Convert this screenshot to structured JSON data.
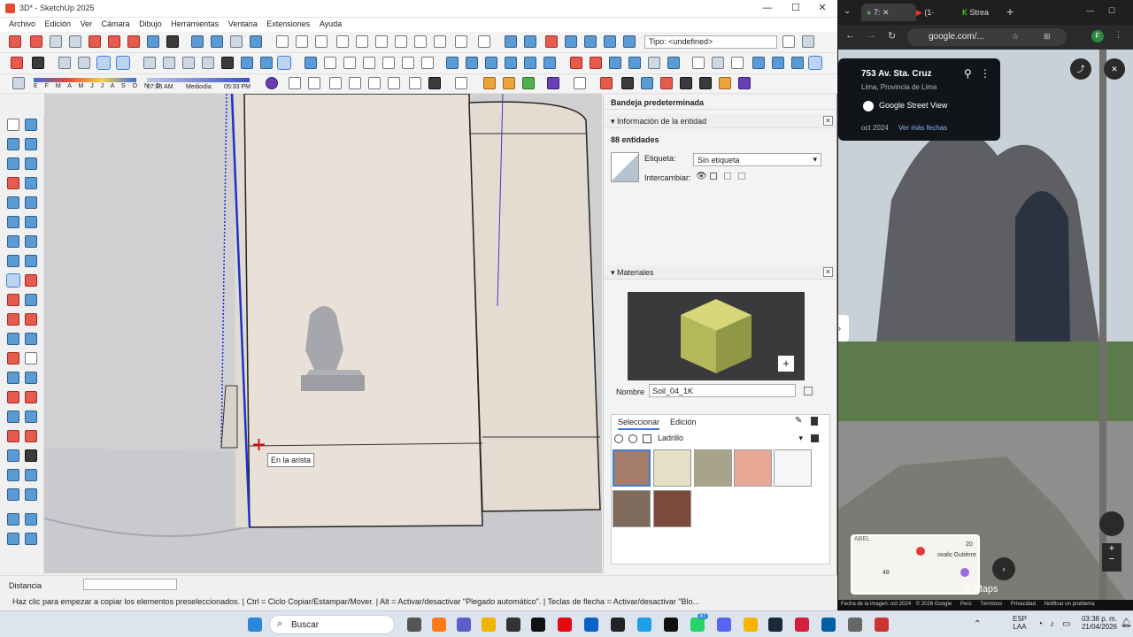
{
  "sketchup": {
    "title": "3D* - SketchUp 2025",
    "menu": [
      "Archivo",
      "Edición",
      "Ver",
      "Cámara",
      "Dibujo",
      "Herramientas",
      "Ventana",
      "Extensiones",
      "Ayuda"
    ],
    "tag_type": "Tipo: <undefined>",
    "shadow": {
      "months": "E F M A M J J A S O N D",
      "time_start": "07:35 AM",
      "time_mid": "Mediodía",
      "time_end": "05:33 PM"
    },
    "tooltip": "En la arista",
    "tray": {
      "title": "Bandeja predeterminada",
      "entity_title": "Información de la entidad",
      "entity_count": "88 entidades",
      "tag_label": "Etiqueta:",
      "tag_value": "Sin etiqueta",
      "toggle_label": "Intercambiar:",
      "materials_title": "Materiales",
      "name_label": "Nombre",
      "name_value": "Soil_04_1K",
      "tab_select": "Seleccionar",
      "tab_edit": "Edición",
      "library": "Ladrillo",
      "swatch_colors": [
        "#a67c6a",
        "#e3e0c6",
        "#a8a48c",
        "#e7a896",
        "#f6f6f6",
        "#7f6b5c",
        "#7b4a3a"
      ]
    },
    "distance_label": "Distancia",
    "status": "Haz clic para empezar a copiar los elementos preseleccionados. | Ctrl = Ciclo Copiar/Estampar/Mover. | Alt = Activar/desactivar \"Plegado automático\". | Teclas de flecha = Activar/desactivar \"Blo..."
  },
  "chrome": {
    "tabs": [
      "7:",
      "(1·",
      "Strea"
    ],
    "url": "google.com/...",
    "sv": {
      "address": "753 Av. Sta. Cruz",
      "city": "Lima, Provincia de Lima",
      "brand": "Google Street View",
      "date": "oct 2024",
      "more": "Ver más fechas",
      "map_label1": "ABEL",
      "map_label2": "ovalo Gutiérre",
      "map_num1": "20",
      "map_num2": "48",
      "maps_text": "le Maps",
      "footer": [
        "Fecha de la imagen: oct 2024",
        "© 2026 Google",
        "Perú",
        "Términos",
        "Privacidad",
        "Notificar un problema"
      ]
    }
  },
  "taskbar": {
    "search": "Buscar",
    "lang1": "ESP",
    "lang2": "LAA",
    "time": "03:38 p. m.",
    "date": "21/04/2026",
    "badge": "37"
  }
}
